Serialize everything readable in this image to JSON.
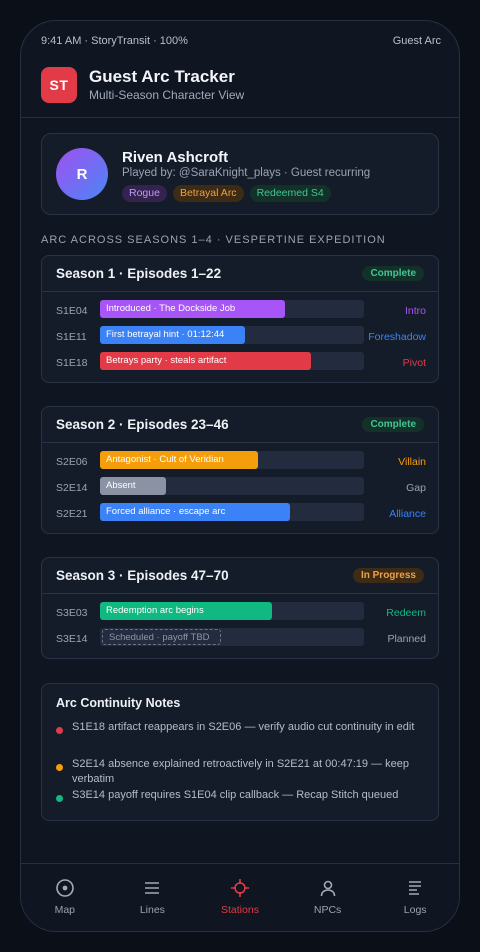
{
  "status": {
    "left": "9:41 AM · StoryTransit · 100%",
    "right": "Guest Arc"
  },
  "header": {
    "icon_text": "ST",
    "title": "Guest Arc Tracker",
    "subtitle": "Multi-Season Character View"
  },
  "profile": {
    "initial": "R",
    "name": "Riven Ashcroft",
    "played_by": "Played by: @SaraKnight_plays · Guest recurring",
    "tags": [
      "Rogue",
      "Betrayal Arc",
      "Redeemed S4"
    ]
  },
  "section_label": "ARC ACROSS SEASONS 1–4 · VESPERTINE EXPEDITION",
  "seasons": [
    {
      "title": "Season 1 · Episodes 1–22",
      "status": "Complete",
      "rows": [
        {
          "ep": "S1E04",
          "label": "Introduced · The Dockside Job",
          "role": "Intro",
          "fill": 0.7,
          "color": "#a855f7"
        },
        {
          "ep": "S1E11",
          "label": "First betrayal hint · 01:12:44",
          "role": "Foreshadow",
          "fill": 0.55,
          "color": "#3b82f6"
        },
        {
          "ep": "S1E18",
          "label": "Betrays party · steals artifact",
          "role": "Pivot",
          "fill": 0.8,
          "color": "#e23b47"
        }
      ]
    },
    {
      "title": "Season 2 · Episodes 23–46",
      "status": "Complete",
      "rows": [
        {
          "ep": "S2E06",
          "label": "Antagonist · Cult of Veridian",
          "role": "Villain",
          "fill": 0.6,
          "color": "#f59e0b"
        },
        {
          "ep": "S2E14",
          "label": "Absent",
          "role": "Gap",
          "fill": 0.25,
          "color": "#8a92a3"
        },
        {
          "ep": "S2E21",
          "label": "Forced alliance · escape arc",
          "role": "Alliance",
          "fill": 0.72,
          "color": "#3b82f6"
        }
      ]
    },
    {
      "title": "Season 3 · Episodes 47–70",
      "status": "In Progress",
      "rows": [
        {
          "ep": "S3E03",
          "label": "Redemption arc begins",
          "role": "Redeem",
          "fill": 0.65,
          "color": "#10b981"
        },
        {
          "ep": "S3E14",
          "label": "Scheduled · payoff TBD",
          "role": "Planned",
          "fill": 0.45,
          "color": "dashed"
        }
      ]
    }
  ],
  "notes": {
    "title": "Arc Continuity Notes",
    "items": [
      {
        "text": "S1E18 artifact reappears in S2E06 — verify audio cut continuity in edit",
        "color": "#e23b47"
      },
      {
        "text": "S2E14 absence explained retroactively in S2E21 at 00:47:19 — keep verbatim",
        "color": "#f59e0b"
      },
      {
        "text": "S3E14 payoff requires S1E04 clip callback — Recap Stitch queued",
        "color": "#10b981"
      }
    ]
  },
  "nav": [
    {
      "label": "Map",
      "icon": "map-icon"
    },
    {
      "label": "Lines",
      "icon": "lines-icon"
    },
    {
      "label": "Stations",
      "icon": "stations-icon",
      "active": true
    },
    {
      "label": "NPCs",
      "icon": "npcs-icon"
    },
    {
      "label": "Logs",
      "icon": "logs-icon"
    }
  ]
}
